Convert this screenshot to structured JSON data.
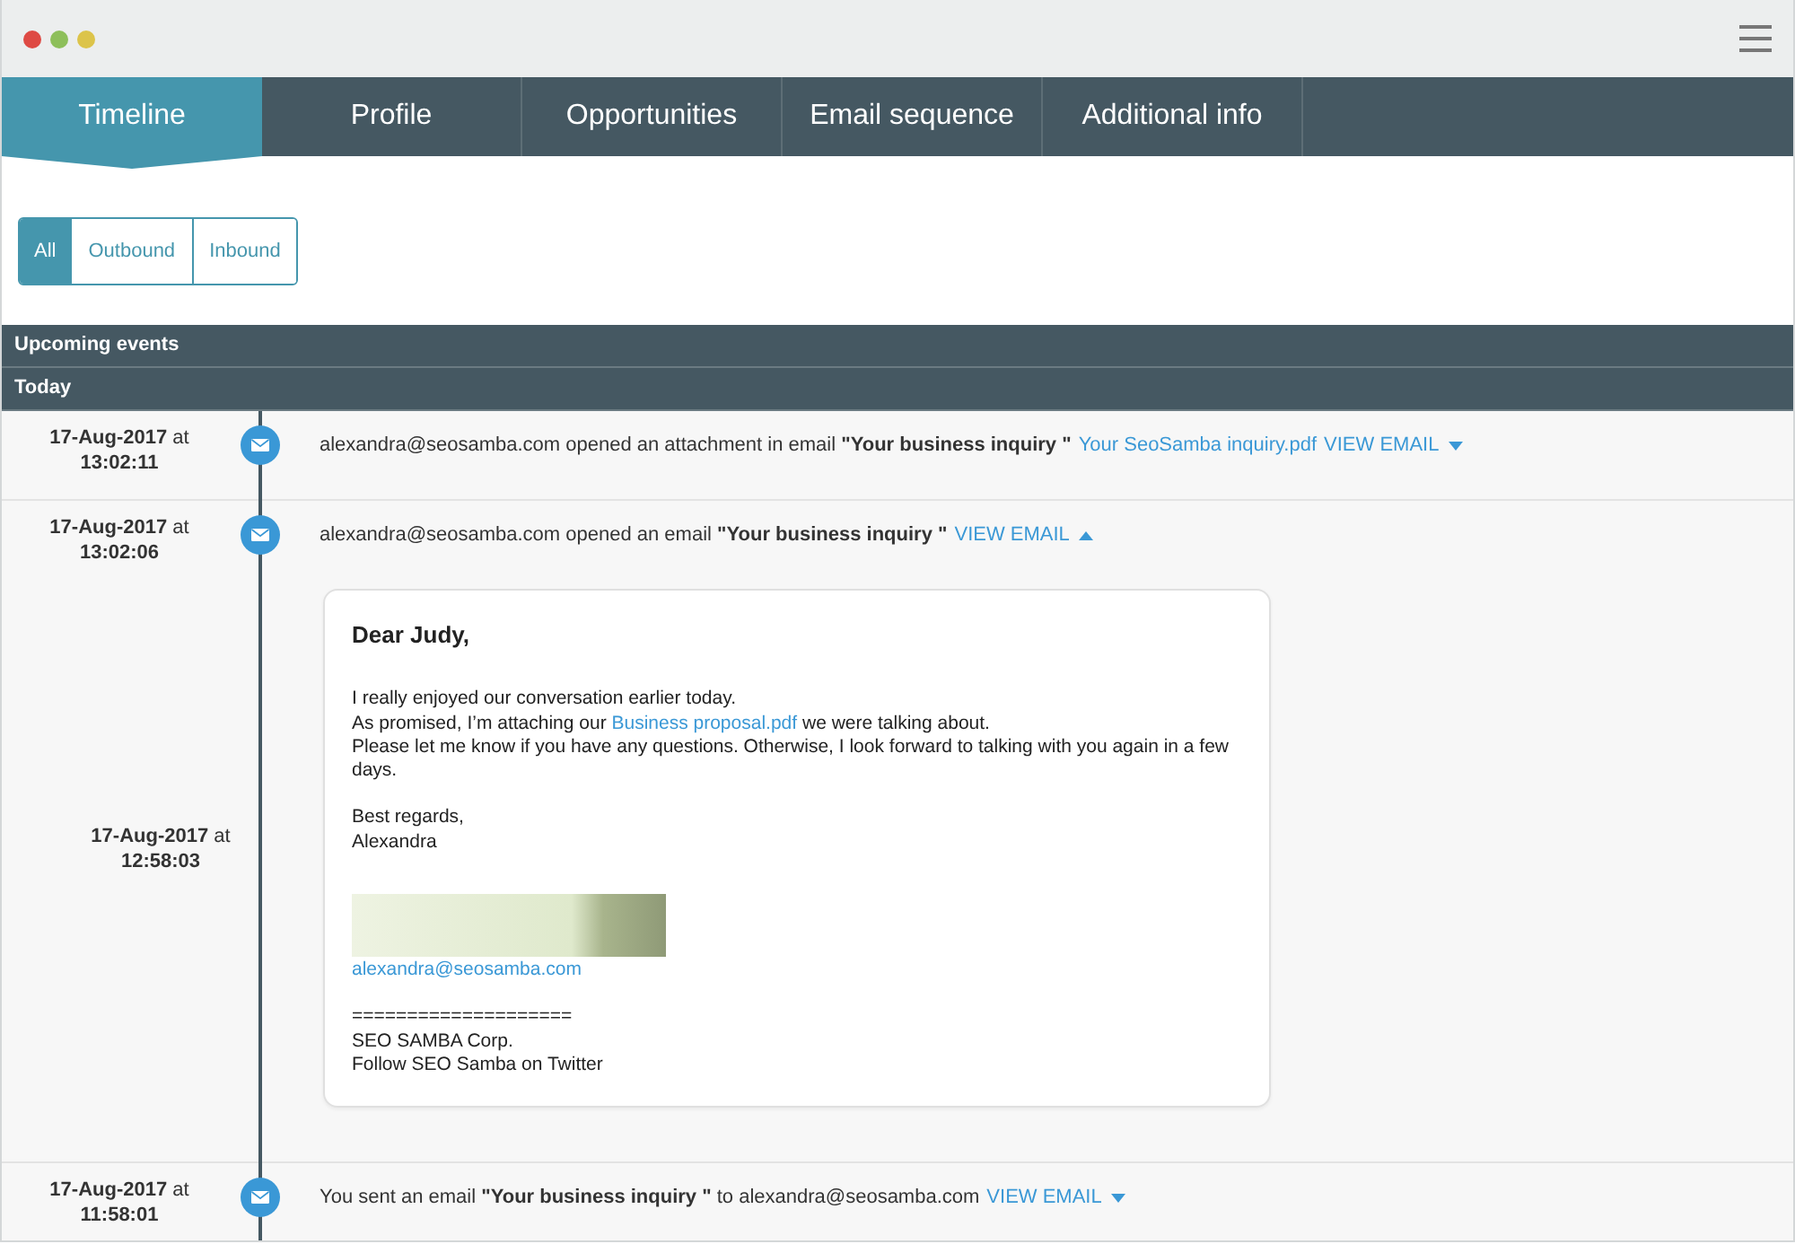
{
  "tabs": [
    {
      "label": "Timeline",
      "selected": true
    },
    {
      "label": "Profile",
      "selected": false
    },
    {
      "label": "Opportunities",
      "selected": false
    },
    {
      "label": "Email sequence",
      "selected": false
    },
    {
      "label": "Additional info",
      "selected": false
    }
  ],
  "filters": [
    {
      "label": "All",
      "selected": true
    },
    {
      "label": "Outbound",
      "selected": false
    },
    {
      "label": "Inbound",
      "selected": false
    }
  ],
  "sections": [
    {
      "title": "Upcoming events"
    },
    {
      "title": "Today"
    }
  ],
  "events": [
    {
      "date": "**17-Aug-2017** at",
      "time": "13:02:11",
      "message": "alexandra@seosamba.com opened an attachment in email **\"Your business inquiry \"**",
      "attachment": "Your SeoSamba inquiry.pdf",
      "view_label": "VIEW EMAIL",
      "expanded": false
    },
    {
      "date": "**17-Aug-2017** at",
      "time": "13:02:06",
      "message": "alexandra@seosamba.com opened an email **\"Your business inquiry \"**",
      "view_label": "VIEW EMAIL",
      "expanded": true,
      "email": {
        "date": "**17-Aug-2017** at",
        "time": "12:58:03",
        "greeting": "Dear Judy,",
        "paragraphs": [
          [
            {
              "text": "I really enjoyed our conversation earlier today."
            },
            {
              "text": "As promised, I’m attaching our ",
              "link": "Business proposal.pdf",
              "after": " we were talking about."
            },
            {
              "text": "Please let me know if you have any questions. Otherwise, I look forward to talking with you again in a few days."
            }
          ],
          [
            {
              "text": "Best regards,"
            },
            {
              "text": "Alexandra"
            }
          ]
        ],
        "signature_email": "alexandra@seosamba.com",
        "signature_lines": [
          "====================",
          "SEO SAMBA Corp.",
          "Follow SEO Samba on Twitter"
        ]
      }
    },
    {
      "date": "**17-Aug-2017** at",
      "time": "11:58:01",
      "message": "You sent an email **\"Your business inquiry \"** to alexandra@seosamba.com",
      "view_label": "VIEW EMAIL",
      "expanded": false
    }
  ]
}
